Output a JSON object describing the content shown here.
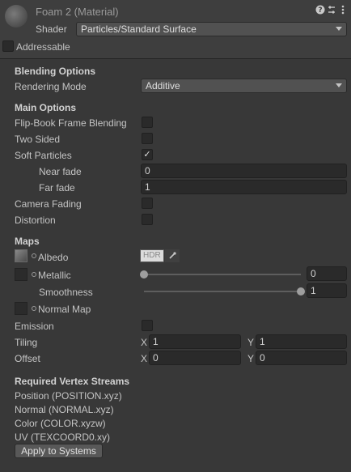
{
  "header": {
    "title": "Foam 2 (Material)",
    "shader_label": "Shader",
    "shader_value": "Particles/Standard Surface",
    "addressable_label": "Addressable",
    "icons": [
      "help-icon",
      "preset-icon",
      "more-icon"
    ]
  },
  "blending": {
    "heading": "Blending Options",
    "rendering_mode_label": "Rendering Mode",
    "rendering_mode_value": "Additive"
  },
  "main_options": {
    "heading": "Main Options",
    "flipbook_label": "Flip-Book Frame Blending",
    "two_sided_label": "Two Sided",
    "soft_particles_label": "Soft Particles",
    "soft_particles_check": "✓",
    "near_fade_label": "Near fade",
    "near_fade_value": "0",
    "far_fade_label": "Far fade",
    "far_fade_value": "1",
    "camera_fading_label": "Camera Fading",
    "distortion_label": "Distortion"
  },
  "maps": {
    "heading": "Maps",
    "albedo_label": "Albedo",
    "hdr_label": "HDR",
    "metallic_label": "Metallic",
    "metallic_value": "0",
    "metallic_level": 0,
    "smoothness_label": "Smoothness",
    "smoothness_value": "1",
    "smoothness_level": 1,
    "normal_map_label": "Normal Map",
    "emission_label": "Emission",
    "tiling_label": "Tiling",
    "tiling_x_label": "X",
    "tiling_x": "1",
    "tiling_y_label": "Y",
    "tiling_y": "1",
    "offset_label": "Offset",
    "offset_x_label": "X",
    "offset_x": "0",
    "offset_y_label": "Y",
    "offset_y": "0"
  },
  "vertex_streams": {
    "heading": "Required Vertex Streams",
    "items": [
      "Position (POSITION.xyz)",
      "Normal (NORMAL.xyz)",
      "Color (COLOR.xyzw)",
      "UV (TEXCOORD0.xy)"
    ],
    "apply_button": "Apply to Systems"
  },
  "colors": {
    "background": "#383838",
    "header_background": "#3e3e3e",
    "field_background": "#2a2a2a"
  }
}
